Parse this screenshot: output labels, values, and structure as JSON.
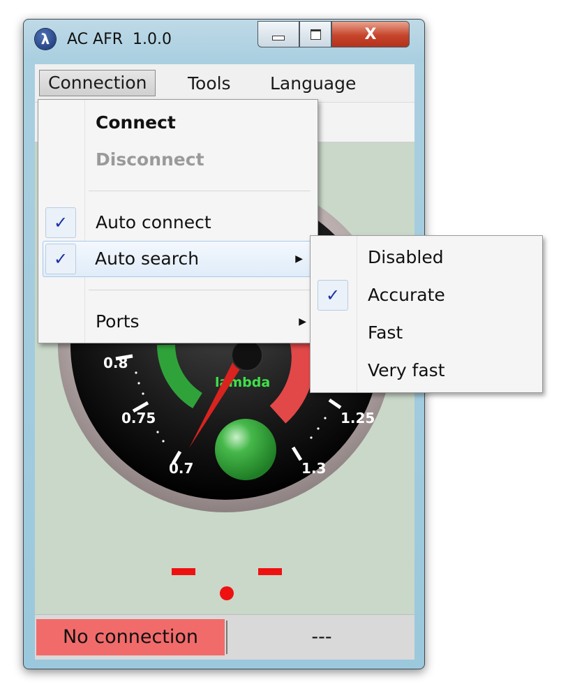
{
  "window": {
    "title": "AC AFR",
    "version": "1.0.0",
    "icon": "lambda-icon",
    "icon_glyph": "λ",
    "close_glyph": "X"
  },
  "menubar": {
    "items": [
      {
        "label": "Connection"
      },
      {
        "label": "Tools"
      },
      {
        "label": "Language"
      }
    ]
  },
  "connection_menu": {
    "connect": "Connect",
    "disconnect": "Disconnect",
    "auto_connect": {
      "label": "Auto connect",
      "checked": true
    },
    "auto_search": {
      "label": "Auto search",
      "checked": true
    },
    "ports": "Ports",
    "check_glyph": "✓",
    "submenu_arrow": "▶"
  },
  "auto_search_submenu": {
    "items": [
      {
        "label": "Disabled",
        "checked": false
      },
      {
        "label": "Accurate",
        "checked": true
      },
      {
        "label": "Fast",
        "checked": false
      },
      {
        "label": "Very fast",
        "checked": false
      }
    ]
  },
  "gauge": {
    "tick_labels": [
      "0.8",
      "0.75",
      "0.7",
      "1.25",
      "1.3"
    ],
    "center_label": "lambda",
    "colors": {
      "green_zone": "#2fa33a",
      "red_zone": "#e24848",
      "needle": "#d9231f",
      "label": "#3fe04a"
    }
  },
  "afr_display": {
    "text": "- . -",
    "color": "#ee1111"
  },
  "statusbar": {
    "connection": "No connection",
    "value": "---",
    "connection_color": "#f26b6b"
  }
}
